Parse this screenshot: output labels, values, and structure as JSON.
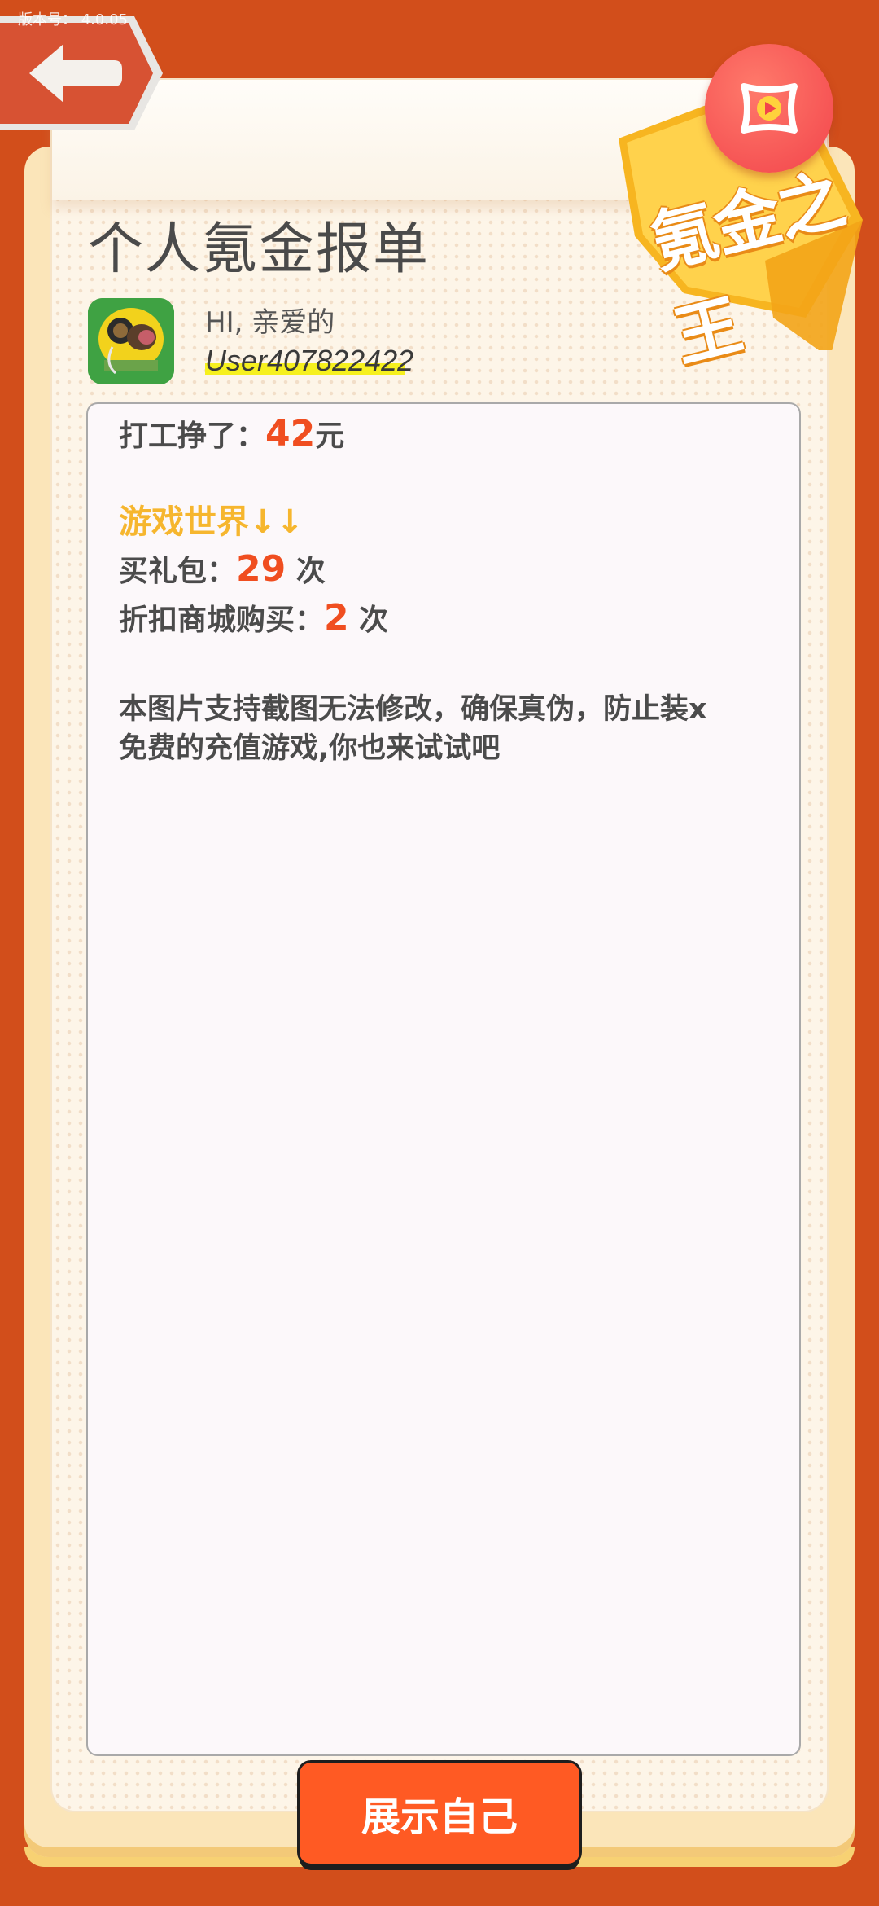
{
  "version_label": "版本号： 4.0.05",
  "title": "个人氪金报单",
  "badge_label": "氪金之王",
  "user": {
    "greeting": "HI, 亲爱的",
    "username": "User407822422"
  },
  "report": {
    "earned_label": "打工挣了：",
    "earned_value": "42",
    "earned_unit": "元",
    "section_title": "游戏世界↓↓",
    "gift_label": "买礼包：",
    "gift_value": "29",
    "gift_unit": " 次",
    "discount_label": "折扣商城购买：",
    "discount_value": "2",
    "discount_unit": " 次",
    "note_line1": "本图片支持截图无法修改，确保真伪，防止装x",
    "note_line2": "免费的充值游戏,你也来试试吧"
  },
  "buttons": {
    "show_self": "展示自己"
  },
  "colors": {
    "background": "#D24E1B",
    "accent_number": "#F04E20",
    "section_title": "#F6B62E",
    "button": "#FF5A23"
  },
  "icons": [
    "back-arrow-icon",
    "video-play-icon",
    "badge-star-icon",
    "avatar-image"
  ]
}
